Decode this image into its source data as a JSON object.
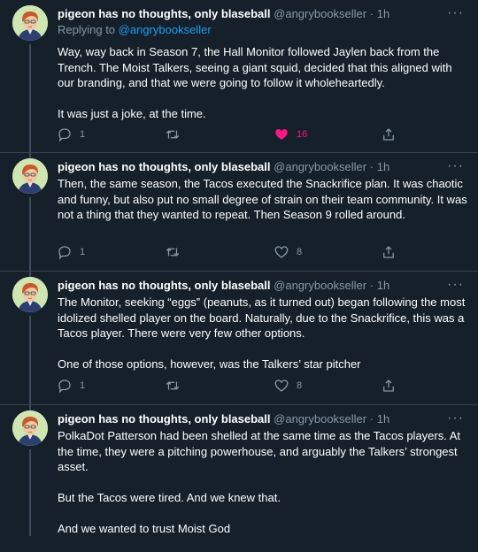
{
  "tweets": [
    {
      "name": "pigeon has no thoughts, only blaseball",
      "handle": "@angrybookseller",
      "time": "1h",
      "replying_label": "Replying to",
      "replying_to": "@angrybookseller",
      "paragraphs": [
        "Way, way back in Season 7, the Hall Monitor followed Jaylen back from the Trench. The Moist Talkers, seeing a giant squid, decided that this aligned with our branding, and that we were going to follow it wholeheartedly.",
        "It was just a joke, at the time."
      ],
      "reply_count": "1",
      "retweet_count": "",
      "like_count": "16",
      "liked": true
    },
    {
      "name": "pigeon has no thoughts, only blaseball",
      "handle": "@angrybookseller",
      "time": "1h",
      "paragraphs": [
        "Then, the same season, the Tacos executed the Snackrifice plan. It was chaotic and funny, but also put no small degree of strain on their team community. It was not a thing that they wanted to repeat. Then Season 9 rolled around."
      ],
      "reply_count": "1",
      "retweet_count": "",
      "like_count": "8",
      "liked": false
    },
    {
      "name": "pigeon has no thoughts, only blaseball",
      "handle": "@angrybookseller",
      "time": "1h",
      "paragraphs": [
        "The Monitor, seeking “eggs” (peanuts, as it turned out) began following the most idolized shelled player on the board. Naturally, due to the Snackrifice, this was a Tacos player. There were very few other options.",
        "One of those options, however, was the Talkers’ star pitcher"
      ],
      "reply_count": "1",
      "retweet_count": "",
      "like_count": "8",
      "liked": false
    },
    {
      "name": "pigeon has no thoughts, only blaseball",
      "handle": "@angrybookseller",
      "time": "1h",
      "paragraphs": [
        "PolkaDot Patterson had been shelled at the same time as the Tacos players. At the time, they were a pitching powerhouse, and arguably the Talkers’ strongest asset.",
        "But the Tacos were tired. And we knew that.",
        "And we wanted to trust Moist God"
      ]
    }
  ],
  "icons": {
    "more": "more-dots-icon",
    "reply": "reply-bubble-icon",
    "retweet": "retweet-icon",
    "like": "heart-icon",
    "share": "share-icon"
  },
  "colors": {
    "background": "#15202b",
    "link": "#1d9bf0",
    "like_active": "#f91880",
    "muted": "#8899a6"
  },
  "labels": {
    "dot": "·",
    "more": "···"
  }
}
